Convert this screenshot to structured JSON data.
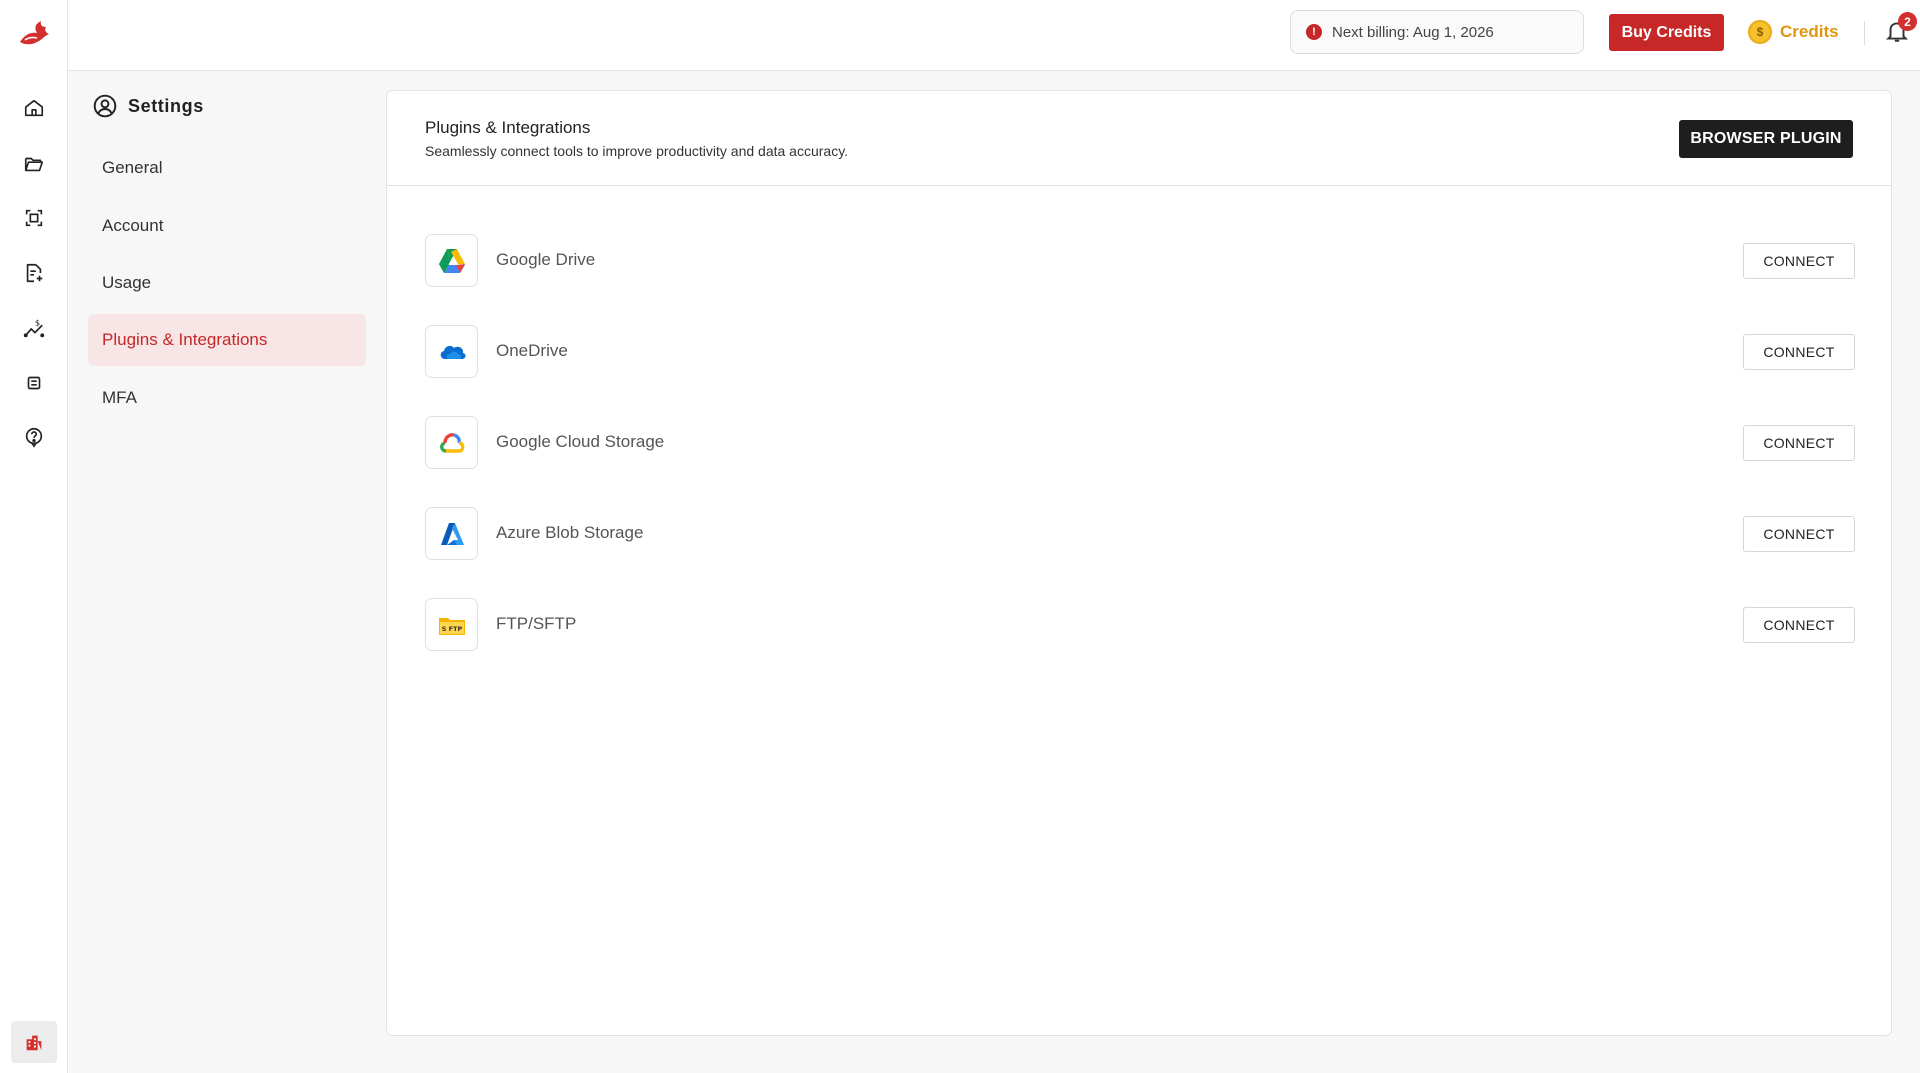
{
  "rail": {
    "icons": [
      "home-icon",
      "folder-icon",
      "scan-icon",
      "document-add-icon",
      "cost-trend-icon",
      "table-icon",
      "help-circle-icon"
    ],
    "bottom_icon": "building-icon"
  },
  "topbar": {
    "billing_text": "Next billing: Aug 1, 2026",
    "buy_credits_label": "Buy Credits",
    "credits_label": "Credits",
    "coin_symbol": "$",
    "notification_count": "2",
    "accent_color": "#c62828"
  },
  "settings": {
    "title": "Settings",
    "nav": [
      {
        "label": "General"
      },
      {
        "label": "Account"
      },
      {
        "label": "Usage"
      },
      {
        "label": "Plugins & Integrations",
        "active": true
      },
      {
        "label": "MFA"
      }
    ]
  },
  "panel": {
    "title": "Plugins & Integrations",
    "subtitle": "Seamlessly connect tools to improve productivity and data accuracy.",
    "browser_plugin_label": "BROWSER PLUGIN",
    "integrations": [
      {
        "name": "Google Drive",
        "icon": "google-drive-icon",
        "action": "CONNECT"
      },
      {
        "name": "OneDrive",
        "icon": "onedrive-icon",
        "action": "CONNECT"
      },
      {
        "name": "Google Cloud Storage",
        "icon": "google-cloud-icon",
        "action": "CONNECT"
      },
      {
        "name": "Azure Blob Storage",
        "icon": "azure-icon",
        "action": "CONNECT"
      },
      {
        "name": "FTP/SFTP",
        "icon": "ftp-folder-icon",
        "action": "CONNECT",
        "icon_text": "S FTP"
      }
    ]
  }
}
